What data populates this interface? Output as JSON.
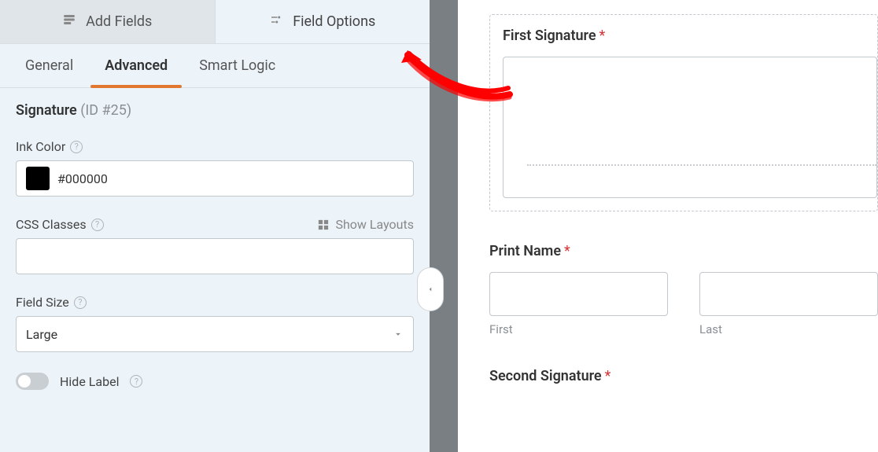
{
  "tabs": {
    "add_fields": "Add Fields",
    "field_options": "Field Options"
  },
  "subtabs": {
    "general": "General",
    "advanced": "Advanced",
    "smart_logic": "Smart Logic"
  },
  "field_header": {
    "name": "Signature",
    "id_label": "(ID #25)"
  },
  "options": {
    "ink_color_label": "Ink Color",
    "ink_color_value": "#000000",
    "css_classes_label": "CSS Classes",
    "css_classes_value": "",
    "show_layouts": "Show Layouts",
    "field_size_label": "Field Size",
    "field_size_value": "Large",
    "hide_label": "Hide Label"
  },
  "preview": {
    "first_signature_label": "First Signature",
    "print_name_label": "Print Name",
    "first_sub": "First",
    "last_sub": "Last",
    "second_signature_label": "Second Signature"
  }
}
